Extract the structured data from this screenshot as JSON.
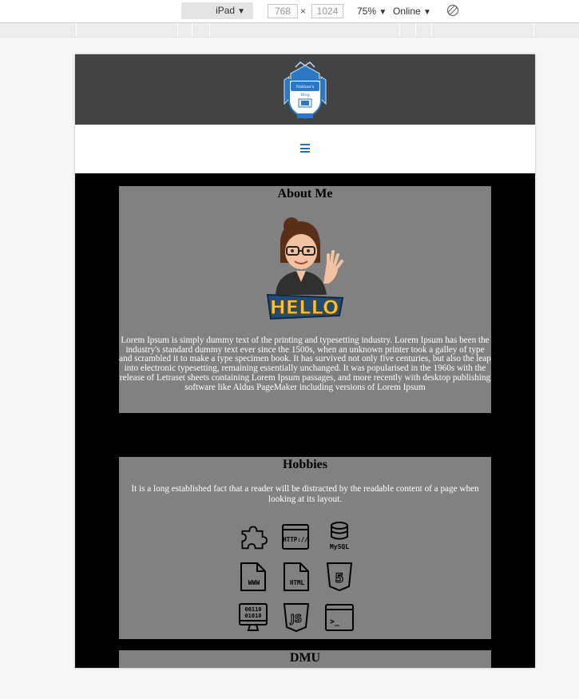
{
  "devtools": {
    "device": "iPad",
    "width": "768",
    "height": "1024",
    "times": "×",
    "zoom": "75%",
    "network": "Online"
  },
  "site": {
    "logo_text_top": "Nathan's",
    "logo_text_bottom": "Blog"
  },
  "about": {
    "heading": "About Me",
    "avatar_caption": "HELLO",
    "body": "Lorem Ipsum is simply dummy text of the printing and typesetting industry. Lorem Ipsum has been the industry's standard dummy text ever since the 1500s, when an unknown printer took a galley of type and scrambled it to make a type specimen book. It has survived not only five centuries, but also the leap into electronic typesetting, remaining essentially unchanged. It was popularised in the 1960s with the release of Letraset sheets containing Lorem Ipsum passages, and more recently with desktop publishing software like Aldus PageMaker including versions of Lorem Ipsum"
  },
  "hobbies": {
    "heading": "Hobbies",
    "body": "It is a long established fact that a reader will be distracted by the readable content of a page when looking at its layout.",
    "icons": [
      {
        "name": "puzzle-icon"
      },
      {
        "name": "http-icon",
        "label": "HTTP://"
      },
      {
        "name": "mysql-icon",
        "label": "MySQL"
      },
      {
        "name": "www-file-icon",
        "label": "WWW"
      },
      {
        "name": "html-file-icon",
        "label": "HTML"
      },
      {
        "name": "html5-icon",
        "label": "5"
      },
      {
        "name": "binary-monitor-icon",
        "label_top": "00110",
        "label_bottom": "01010"
      },
      {
        "name": "javascript-icon",
        "label": "JS"
      },
      {
        "name": "terminal-icon",
        "label": ">_"
      }
    ]
  },
  "dmu": {
    "heading": "DMU"
  },
  "colors": {
    "header_bg": "#434343",
    "card_bg": "#818181",
    "page_bg": "#000000",
    "menu_accent": "#2b6cb7"
  }
}
